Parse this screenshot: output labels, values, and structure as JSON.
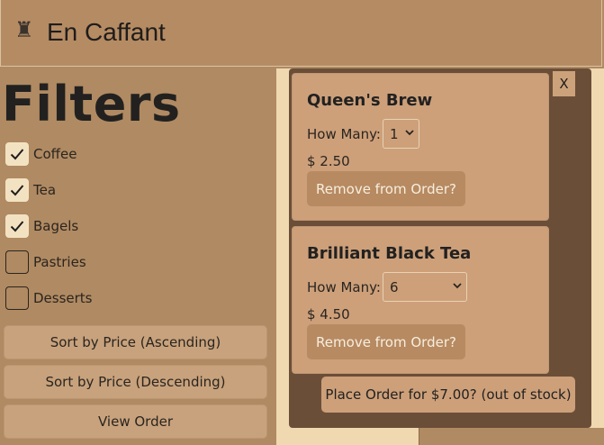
{
  "header": {
    "logo_icon": "rook-icon",
    "logo_glyph": "♜",
    "title": "En Caffant"
  },
  "filters": {
    "title": "Filters",
    "items": [
      {
        "label": "Coffee",
        "checked": true
      },
      {
        "label": "Tea",
        "checked": true
      },
      {
        "label": "Bagels",
        "checked": true
      },
      {
        "label": "Pastries",
        "checked": false
      },
      {
        "label": "Desserts",
        "checked": false
      }
    ]
  },
  "actions": {
    "sort_asc": "Sort by Price (Ascending)",
    "sort_desc": "Sort by Price (Descending)",
    "view_order": "View Order"
  },
  "order_panel": {
    "close_label": "X",
    "how_many_label": "How Many:",
    "remove_label": "Remove from Order?",
    "items": [
      {
        "name": "Queen's Brew",
        "quantity": "1",
        "price": "$ 2.50"
      },
      {
        "name": "Brilliant Black Tea",
        "quantity": "6",
        "price": "$ 4.50"
      }
    ],
    "place_order_label": "Place Order for $7.00? (out of stock)"
  },
  "colors": {
    "background": "#b08a62",
    "panel": "#6b4e38",
    "card": "#cda07a",
    "accent_button": "#b78a62"
  }
}
